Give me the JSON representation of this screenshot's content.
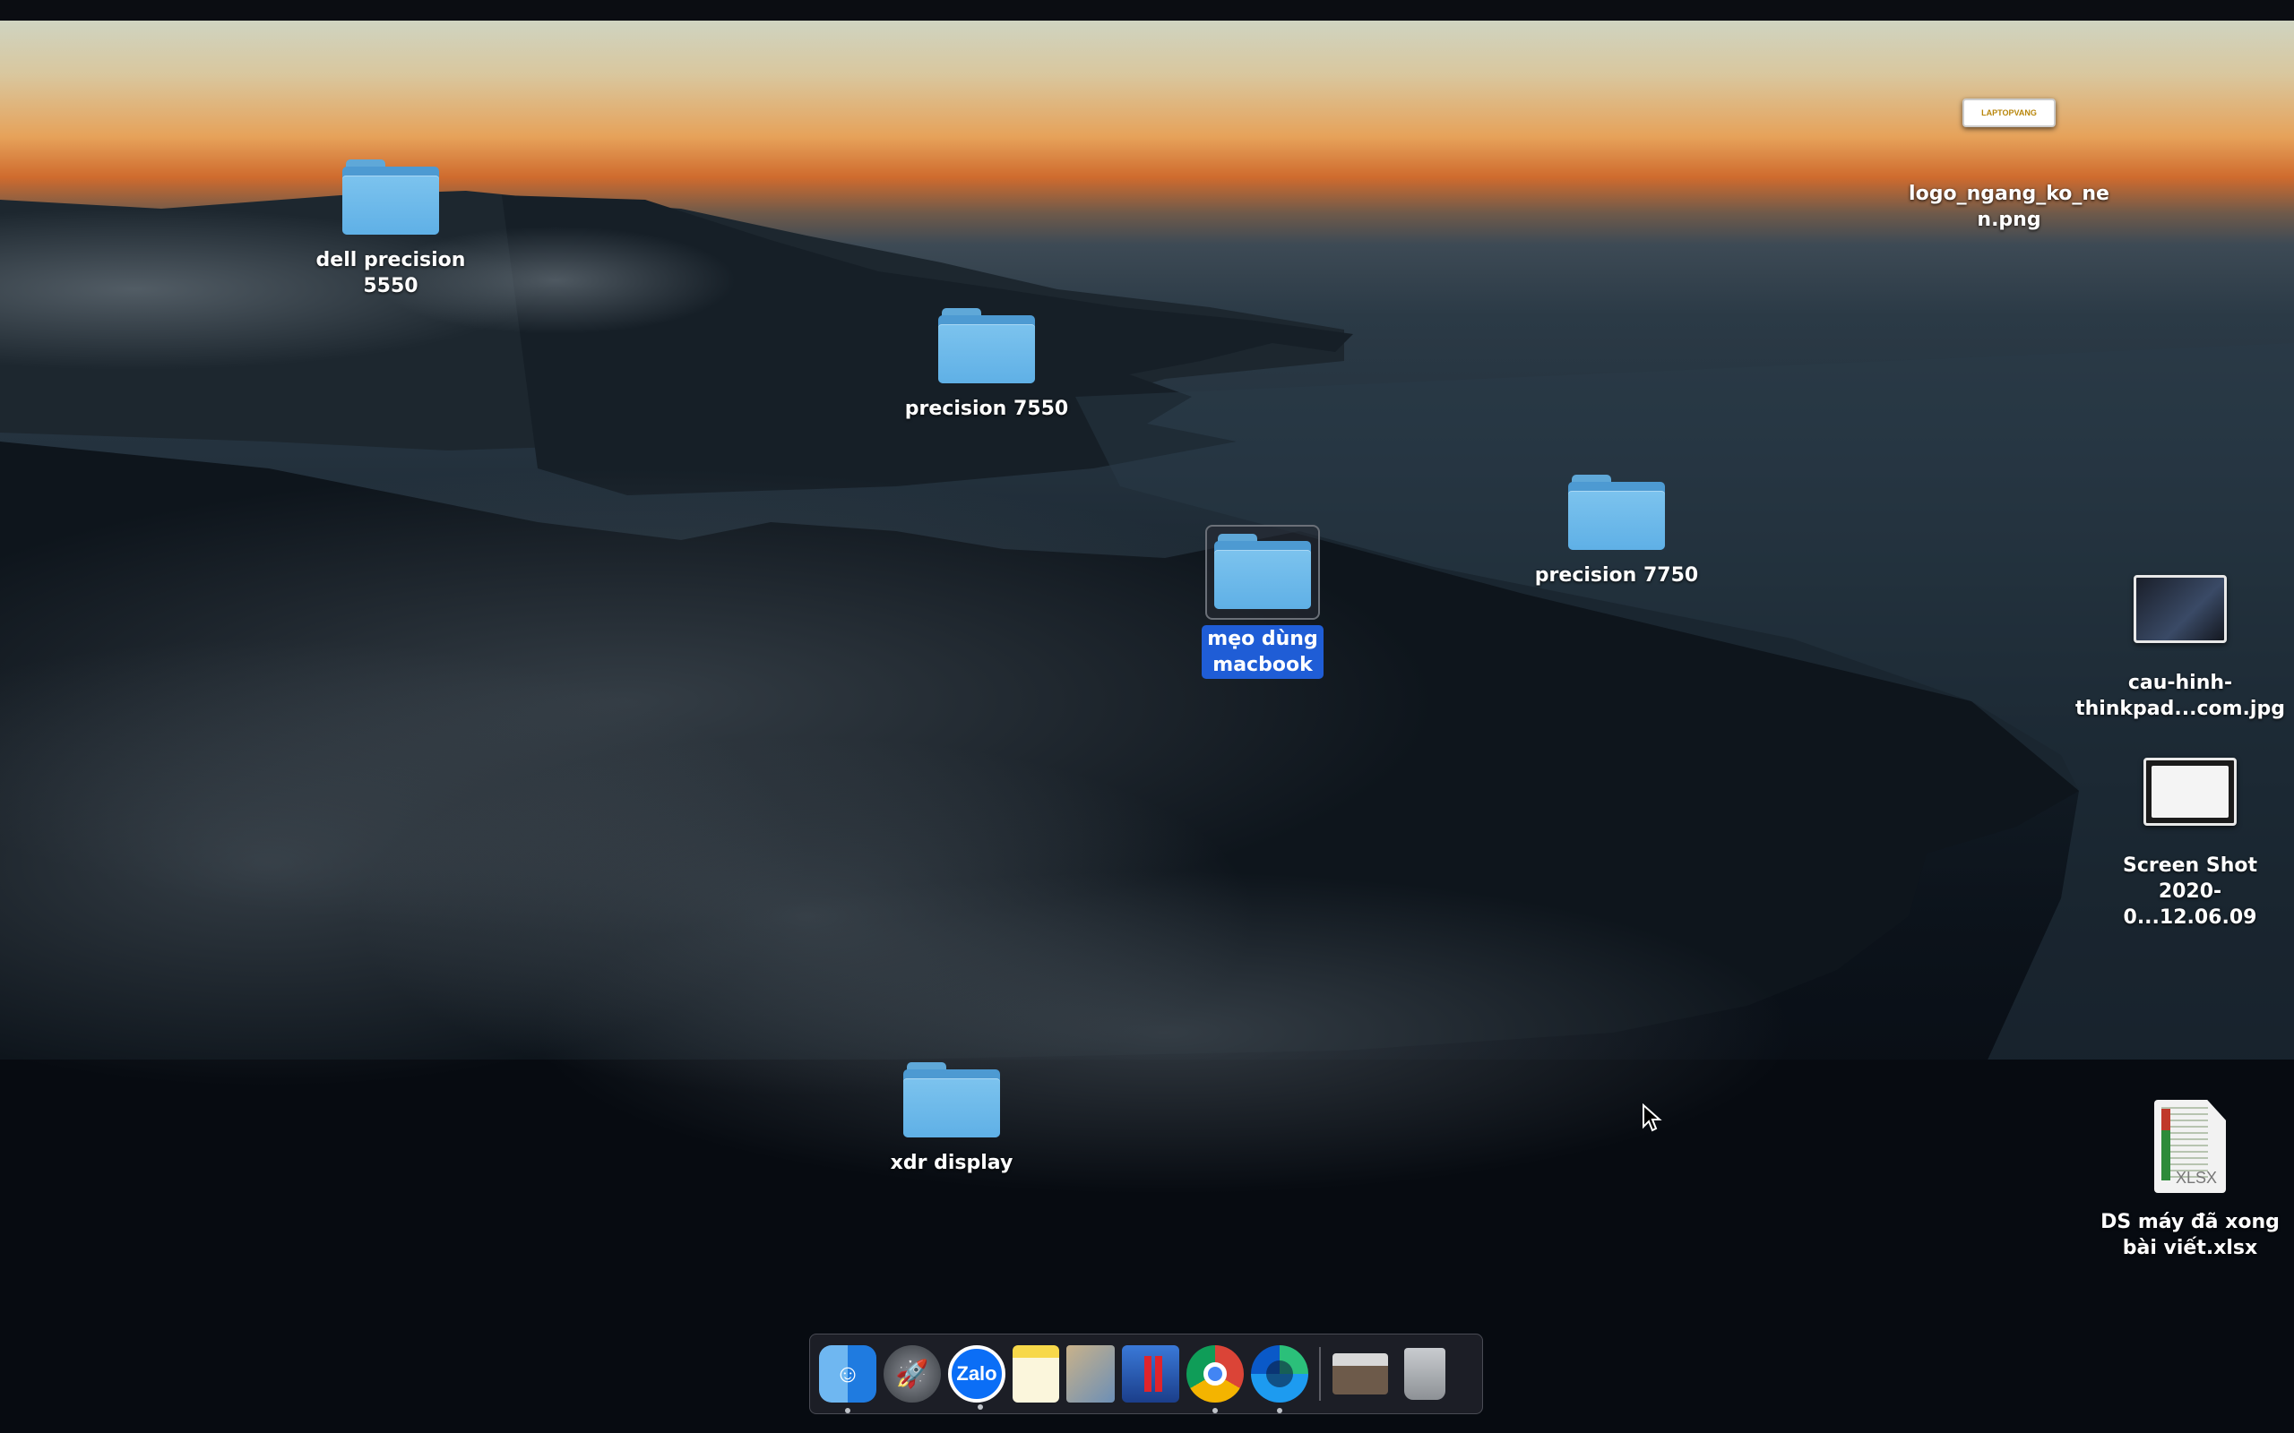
{
  "desktop": {
    "items": [
      {
        "id": "dell-precision-5550",
        "type": "folder",
        "label": "dell precision\n5550"
      },
      {
        "id": "precision-7550",
        "type": "folder",
        "label": "precision 7550"
      },
      {
        "id": "precision-7750",
        "type": "folder",
        "label": "precision 7750"
      },
      {
        "id": "meo-dung-macbook",
        "type": "folder",
        "label": "mẹo dùng\nmacbook",
        "selected": true
      },
      {
        "id": "xdr-display",
        "type": "folder",
        "label": "xdr display"
      },
      {
        "id": "logo-file",
        "type": "image",
        "label": "logo_ngang_ko_ne\nn.png",
        "thumb_text": "LAPTOPVANG"
      },
      {
        "id": "cau-hinh-file",
        "type": "image",
        "label": "cau-hinh-\nthinkpad...com.jpg"
      },
      {
        "id": "screenshot-file",
        "type": "image",
        "label": "Screen Shot\n2020-0...12.06.09"
      },
      {
        "id": "xlsx-file",
        "type": "spreadsheet",
        "label": "DS máy đã xong\nbài viết.xlsx",
        "ext": "XLSX"
      }
    ]
  },
  "dock": {
    "apps": [
      {
        "name": "Finder",
        "running": true
      },
      {
        "name": "Launchpad",
        "running": false
      },
      {
        "name": "Zalo",
        "label": "Zalo",
        "running": true
      },
      {
        "name": "Notes",
        "running": false
      },
      {
        "name": "Preview",
        "running": false
      },
      {
        "name": "Parallels",
        "running": false
      },
      {
        "name": "Google Chrome",
        "running": true
      },
      {
        "name": "Microsoft Edge",
        "running": true
      },
      {
        "name": "Downloads stack",
        "running": false
      },
      {
        "name": "Trash",
        "running": false
      }
    ]
  },
  "colors": {
    "selection": "#1f5dd6",
    "folder": "#6ab8ea"
  }
}
